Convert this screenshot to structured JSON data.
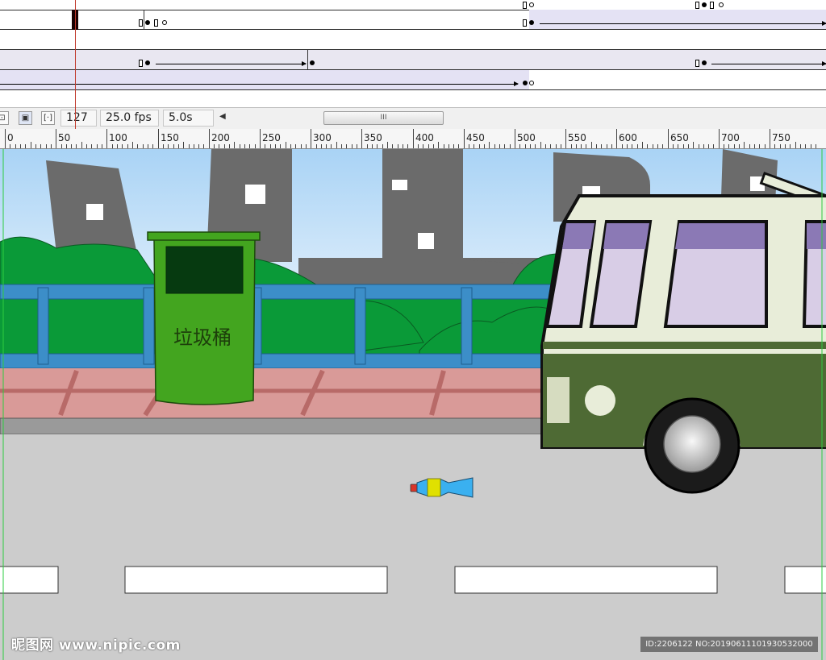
{
  "timeline": {
    "current_frame": "127",
    "frame_rate": "25.0 fps",
    "elapsed_time": "5.0s",
    "scroll_thumb_grip": "III"
  },
  "ruler": {
    "labels": [
      "0",
      "50",
      "100",
      "150",
      "200",
      "250",
      "300",
      "350",
      "400",
      "450",
      "500",
      "550",
      "600",
      "650",
      "700",
      "750"
    ]
  },
  "stage": {
    "trash_bin_label": "垃圾桶"
  },
  "watermark": {
    "site": "昵图网 www.nipic.com",
    "image_id": "ID:2206122 NO:20190611101930532000"
  },
  "colors": {
    "sky_top": "#a9d3f5",
    "building": "#6b6b6b",
    "bush": "#0a9a38",
    "railing": "#3c8ec8",
    "sidewalk": "#d99a98",
    "road": "#cccccc",
    "bin": "#43a51f",
    "bus_body": "#e8edd9",
    "bus_lower": "#4e6a34",
    "bus_window": "#d8cde6",
    "playhead": "#c0392b"
  },
  "icons": [
    "onion-skin-icon",
    "onion-outline-icon",
    "edit-multiple-frames-icon",
    "scroll-left-arrow-icon"
  ]
}
